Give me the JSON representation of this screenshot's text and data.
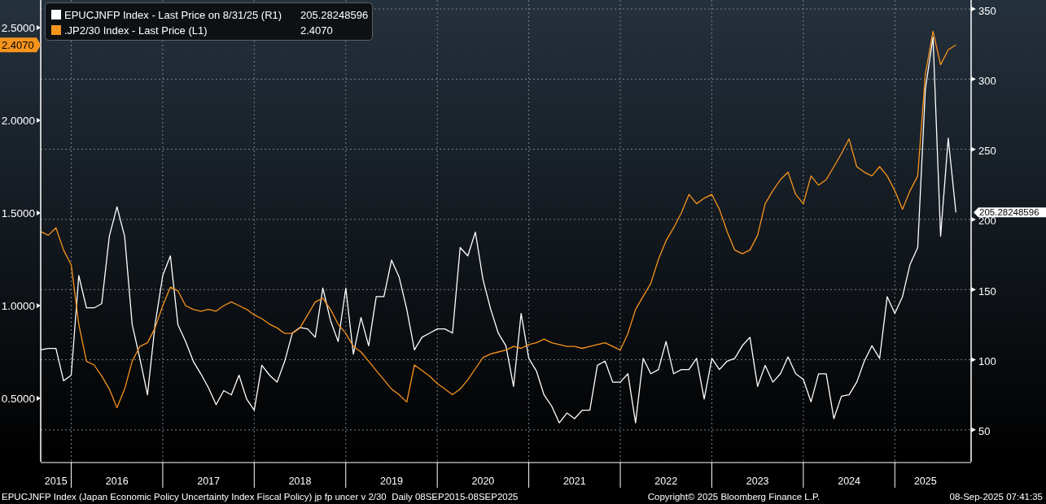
{
  "legend": [
    {
      "label": "EPUCJNFP Index - Last Price on 8/31/25 (R1)",
      "value": "205.28248596",
      "color": "#ffffff"
    },
    {
      "label": ".JP2/30 Index - Last Price (L1)",
      "value": "2.4070",
      "color": "#f7941d"
    }
  ],
  "chart_data": {
    "type": "line",
    "x": [
      "2015-09",
      "2015-10",
      "2015-11",
      "2015-12",
      "2016-01",
      "2016-02",
      "2016-03",
      "2016-04",
      "2016-05",
      "2016-06",
      "2016-07",
      "2016-08",
      "2016-09",
      "2016-10",
      "2016-11",
      "2016-12",
      "2017-01",
      "2017-02",
      "2017-03",
      "2017-04",
      "2017-05",
      "2017-06",
      "2017-07",
      "2017-08",
      "2017-09",
      "2017-10",
      "2017-11",
      "2017-12",
      "2018-01",
      "2018-02",
      "2018-03",
      "2018-04",
      "2018-05",
      "2018-06",
      "2018-07",
      "2018-08",
      "2018-09",
      "2018-10",
      "2018-11",
      "2018-12",
      "2019-01",
      "2019-02",
      "2019-03",
      "2019-04",
      "2019-05",
      "2019-06",
      "2019-07",
      "2019-08",
      "2019-09",
      "2019-10",
      "2019-11",
      "2019-12",
      "2020-01",
      "2020-02",
      "2020-03",
      "2020-04",
      "2020-05",
      "2020-06",
      "2020-07",
      "2020-08",
      "2020-09",
      "2020-10",
      "2020-11",
      "2020-12",
      "2021-01",
      "2021-02",
      "2021-03",
      "2021-04",
      "2021-05",
      "2021-06",
      "2021-07",
      "2021-08",
      "2021-09",
      "2021-10",
      "2021-11",
      "2021-12",
      "2022-01",
      "2022-02",
      "2022-03",
      "2022-04",
      "2022-05",
      "2022-06",
      "2022-07",
      "2022-08",
      "2022-09",
      "2022-10",
      "2022-11",
      "2022-12",
      "2023-01",
      "2023-02",
      "2023-03",
      "2023-04",
      "2023-05",
      "2023-06",
      "2023-07",
      "2023-08",
      "2023-09",
      "2023-10",
      "2023-11",
      "2023-12",
      "2024-01",
      "2024-02",
      "2024-03",
      "2024-04",
      "2024-05",
      "2024-06",
      "2024-07",
      "2024-08",
      "2024-09",
      "2024-10",
      "2024-11",
      "2024-12",
      "2025-01",
      "2025-02",
      "2025-03",
      "2025-04",
      "2025-05",
      "2025-06",
      "2025-07",
      "2025-08",
      "2025-09"
    ],
    "xlim": [
      "2015-09",
      "2025-11"
    ],
    "grid": true,
    "series": [
      {
        "color": "#ffffff",
        "axis": "y2",
        "values": [
          107,
          108,
          108,
          85,
          89,
          160,
          137,
          137,
          140,
          188,
          209,
          188,
          125,
          101,
          75,
          125,
          160,
          174,
          125,
          113,
          99,
          90,
          80,
          68,
          78,
          75,
          89,
          72,
          64,
          96,
          89,
          84,
          99,
          119,
          123,
          122,
          116,
          151,
          128,
          113,
          151,
          104,
          130,
          110,
          145,
          145,
          171,
          159,
          136,
          107,
          116,
          119,
          122,
          122,
          119,
          180,
          174,
          191,
          157,
          136,
          119,
          110,
          81,
          133,
          101,
          92,
          75,
          67,
          55,
          62,
          58,
          64,
          64,
          96,
          99,
          84,
          84,
          90,
          55,
          101,
          90,
          93,
          113,
          90,
          93,
          93,
          101,
          72,
          101,
          93,
          99,
          101,
          110,
          116,
          81,
          96,
          84,
          90,
          102,
          90,
          86,
          70,
          90,
          90,
          58,
          74,
          75,
          84,
          99,
          110,
          101,
          145,
          133,
          145,
          168,
          180,
          293,
          330,
          188,
          258,
          205
        ]
      },
      {
        "color": "#f7941d",
        "values": [
          1.4,
          1.38,
          1.42,
          1.3,
          1.22,
          0.9,
          0.7,
          0.68,
          0.62,
          0.55,
          0.45,
          0.55,
          0.7,
          0.78,
          0.8,
          0.88,
          1.0,
          1.1,
          1.08,
          1.0,
          0.98,
          0.97,
          0.98,
          0.97,
          1.0,
          1.02,
          1.0,
          0.98,
          0.95,
          0.93,
          0.9,
          0.88,
          0.85,
          0.85,
          0.88,
          0.95,
          1.02,
          1.04,
          0.98,
          0.9,
          0.85,
          0.78,
          0.75,
          0.7,
          0.65,
          0.6,
          0.55,
          0.52,
          0.48,
          0.68,
          0.65,
          0.62,
          0.58,
          0.55,
          0.52,
          0.55,
          0.6,
          0.66,
          0.72,
          0.74,
          0.75,
          0.76,
          0.78,
          0.77,
          0.79,
          0.8,
          0.82,
          0.8,
          0.79,
          0.78,
          0.78,
          0.77,
          0.78,
          0.79,
          0.8,
          0.78,
          0.76,
          0.85,
          0.98,
          1.05,
          1.12,
          1.25,
          1.35,
          1.42,
          1.5,
          1.6,
          1.55,
          1.58,
          1.6,
          1.52,
          1.4,
          1.3,
          1.28,
          1.3,
          1.38,
          1.55,
          1.62,
          1.68,
          1.72,
          1.6,
          1.55,
          1.7,
          1.65,
          1.68,
          1.75,
          1.82,
          1.9,
          1.75,
          1.72,
          1.7,
          1.75,
          1.7,
          1.62,
          1.52,
          1.62,
          1.7,
          2.25,
          2.48,
          2.3,
          2.38,
          2.407
        ]
      }
    ],
    "ylim": [
      0.158,
      2.649
    ],
    "yticks": [
      {
        "value": 2.5,
        "label": "2.5000"
      },
      {
        "value": 2.0,
        "label": "2.0000"
      },
      {
        "value": 1.5,
        "label": "1.5000"
      },
      {
        "value": 1.0,
        "label": "1.0000"
      },
      {
        "value": 0.5,
        "label": "0.5000"
      }
    ],
    "y2lim": [
      27.3,
      356.4
    ],
    "y2ticks": [
      350,
      300,
      250,
      200,
      150,
      100,
      50
    ],
    "xticks": [
      {
        "value": "2015-11",
        "label": "2015"
      },
      {
        "value": "2016-07",
        "label": "2016"
      },
      {
        "value": "2017-07",
        "label": "2017"
      },
      {
        "value": "2018-07",
        "label": "2018"
      },
      {
        "value": "2019-07",
        "label": "2019"
      },
      {
        "value": "2020-07",
        "label": "2020"
      },
      {
        "value": "2021-07",
        "label": "2021"
      },
      {
        "value": "2022-07",
        "label": "2022"
      },
      {
        "value": "2023-07",
        "label": "2023"
      },
      {
        "value": "2024-07",
        "label": "2024"
      },
      {
        "value": "2025-05",
        "label": "2025"
      }
    ]
  },
  "last_value_tags": [
    {
      "text": "205.28248596",
      "color": "#ffffff"
    },
    {
      "text": "2.4070",
      "color": "#f7941d"
    }
  ],
  "footer": {
    "description": "EPUCJNFP Index (Japan Economic Policy Uncertainty Index Fiscal Policy) jp fp uncer v 2/30  Daily 08SEP2015-08SEP2025",
    "copyright": "Copyright© 2025 Bloomberg Finance L.P.",
    "timestamp": "08-Sep-2025 07:41:35"
  }
}
